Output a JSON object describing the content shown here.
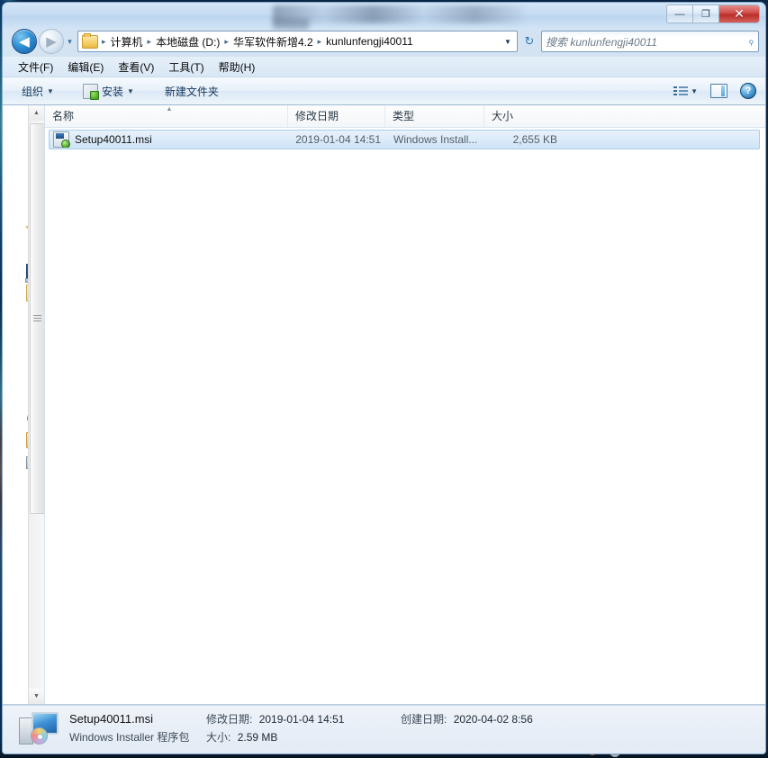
{
  "window": {
    "controls": {
      "minimize": "—",
      "maximize": "❐",
      "close": "✕"
    }
  },
  "navigation": {
    "back_label": "◀",
    "forward_label": "▶",
    "history_label": "▾",
    "breadcrumbs": [
      "计算机",
      "本地磁盘 (D:)",
      "华军软件新增4.2",
      "kunlunfengji40011"
    ],
    "separator": "▸",
    "dropdown_label": "▼",
    "refresh_label": "↻"
  },
  "search": {
    "placeholder": "搜索 kunlunfengji40011",
    "icon": "search-icon",
    "glyph": "⌕"
  },
  "menubar": {
    "items": [
      "文件(F)",
      "编辑(E)",
      "查看(V)",
      "工具(T)",
      "帮助(H)"
    ]
  },
  "toolbar": {
    "organize_label": "组织",
    "install_label": "安装",
    "new_folder_label": "新建文件夹",
    "caret": "▼",
    "view_icon": "view-options-icon",
    "preview_pane_icon": "preview-pane-icon",
    "help_icon": "help-icon",
    "help_glyph": "?"
  },
  "navpane": {
    "icons": [
      {
        "name": "favorites-star-icon",
        "glyph": "★"
      },
      {
        "name": "desktop-icon"
      },
      {
        "name": "libraries-icon"
      },
      {
        "name": "network-icon"
      },
      {
        "name": "folder-icon"
      },
      {
        "name": "computer-icon"
      }
    ],
    "scroll_up": "▲",
    "scroll_down": "▼"
  },
  "filelist": {
    "columns": [
      {
        "key": "name",
        "label": "名称",
        "sorted": true
      },
      {
        "key": "date",
        "label": "修改日期",
        "sorted": false
      },
      {
        "key": "type",
        "label": "类型",
        "sorted": false
      },
      {
        "key": "size",
        "label": "大小",
        "sorted": false
      }
    ],
    "rows": [
      {
        "name": "Setup40011.msi",
        "date": "2019-01-04 14:51",
        "type": "Windows Install...",
        "size": "2,655 KB",
        "selected": true,
        "icon": "msi-installer-icon"
      }
    ]
  },
  "details": {
    "file_name": "Setup40011.msi",
    "file_kind": "Windows Installer 程序包",
    "modified_label": "修改日期:",
    "modified_value": "2019-01-04 14:51",
    "created_label": "创建日期:",
    "created_value": "2020-04-02 8:56",
    "size_label": "大小:",
    "size_value": "2.59 MB",
    "icon": "msi-package-large-icon"
  },
  "taskbar": {
    "ie_icon": "internet-explorer-icon",
    "tray_glyphs": "▴ ⬤ ☗ ▭ ▪ ▫"
  },
  "colors": {
    "accent": "#2f8fd4",
    "selection": "#cfe4f7",
    "close_button": "#cf4b47",
    "window_chrome": "#cee3f6"
  }
}
